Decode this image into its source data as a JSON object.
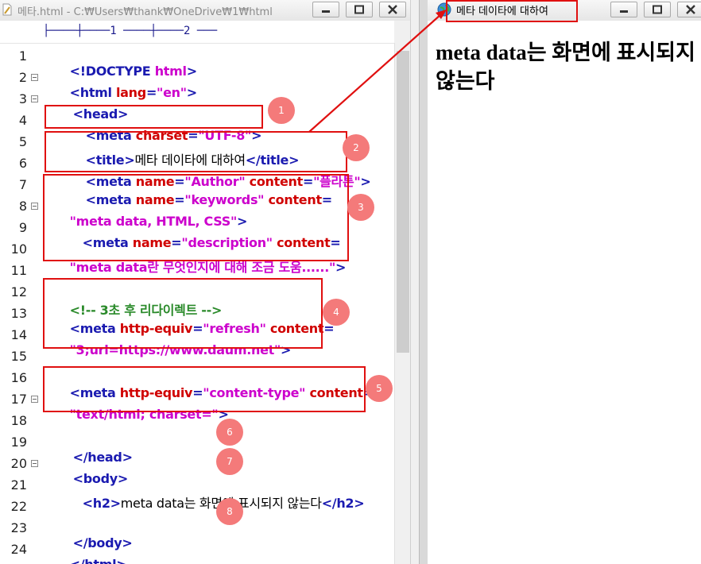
{
  "editor": {
    "title": "메타.html - C:₩Users₩thank₩OneDrive₩1₩html",
    "ruler": "├────┼────1 ────┼────2 ───",
    "line_numbers": [
      "1",
      "2",
      "3",
      "4",
      "5",
      "6",
      "7",
      "8",
      "9",
      "10",
      "11",
      "12",
      "13",
      "14",
      "15",
      "16",
      "17",
      "18",
      "19",
      "20",
      "21",
      "22",
      "23",
      "24"
    ],
    "code": {
      "l1": {
        "p1": "<!DOCTYPE ",
        "p2": "html",
        "p3": ">"
      },
      "l2": {
        "p1": "<html ",
        "p2": "lang",
        "p3": "=",
        "p4": "\"en\"",
        "p5": ">"
      },
      "l3": {
        "p1": "<head>"
      },
      "l4": {
        "p1": "<meta ",
        "p2": "charset",
        "p3": "=",
        "p4": "\"UTF-8\"",
        "p5": ">"
      },
      "l5": {
        "p1": "<title>",
        "p2": "메타 데이타에 대하여",
        "p3": "</title>"
      },
      "l6": {
        "p1": "<meta ",
        "p2": "name",
        "p3": "=",
        "p4": "\"Author\"",
        "p5": " content",
        "p6": "=",
        "p7": "\"플라톤\"",
        "p8": ">"
      },
      "l7": {
        "p1": "<meta ",
        "p2": "name",
        "p3": "=",
        "p4": "\"keywords\"",
        "p5": " content",
        "p6": "="
      },
      "l8": {
        "p1": "\"meta data, HTML, CSS\"",
        "p2": ">"
      },
      "l9": {
        "p1": "<meta ",
        "p2": "name",
        "p3": "=",
        "p4": "\"description\"",
        "p5": " content",
        "p6": "="
      },
      "l10": {
        "p1": "\"meta data란 무엇인지에 대해 조금 도움......\"",
        "p2": ">"
      },
      "l12": {
        "p1": "<!-- 3초 후 리다이렉트 -->"
      },
      "l13": {
        "p1": "<meta ",
        "p2": "http-equiv",
        "p3": "=",
        "p4": "\"refresh\"",
        "p5": " content",
        "p6": "="
      },
      "l14": {
        "p1": "\"3;url=https://www.daum.net\"",
        "p2": ">"
      },
      "l16": {
        "p1": "<meta ",
        "p2": "http-equiv",
        "p3": "=",
        "p4": "\"content-type\"",
        "p5": " content",
        "p6": "="
      },
      "l17": {
        "p1": "\"text/html; charset=\"",
        "p2": ">"
      },
      "l19": {
        "p1": "</head>"
      },
      "l20": {
        "p1": "<body>"
      },
      "l21": {
        "p1": "<h2>",
        "p2": "meta data는 화면에 표시되지 않는다",
        "p3": "</h2>"
      },
      "l23": {
        "p1": "</body>"
      },
      "l24": {
        "p1": "</html>"
      }
    }
  },
  "browser": {
    "title": "메타 데이타에 대하여",
    "heading": "meta data는 화면에 표시되지 않는다"
  },
  "annotations": {
    "badges": [
      "1",
      "2",
      "3",
      "4",
      "5",
      "6",
      "7",
      "8"
    ]
  },
  "colors": {
    "tag": "#1a1ab0",
    "attribute": "#d00000",
    "value": "#cc00cc",
    "comment": "#2a8a2a",
    "annotation": "#e01010",
    "badge": "#f47a7a"
  },
  "icons": [
    "document-icon",
    "minimize-icon",
    "maximize-icon",
    "close-icon",
    "globe-icon",
    "fold-icon"
  ]
}
